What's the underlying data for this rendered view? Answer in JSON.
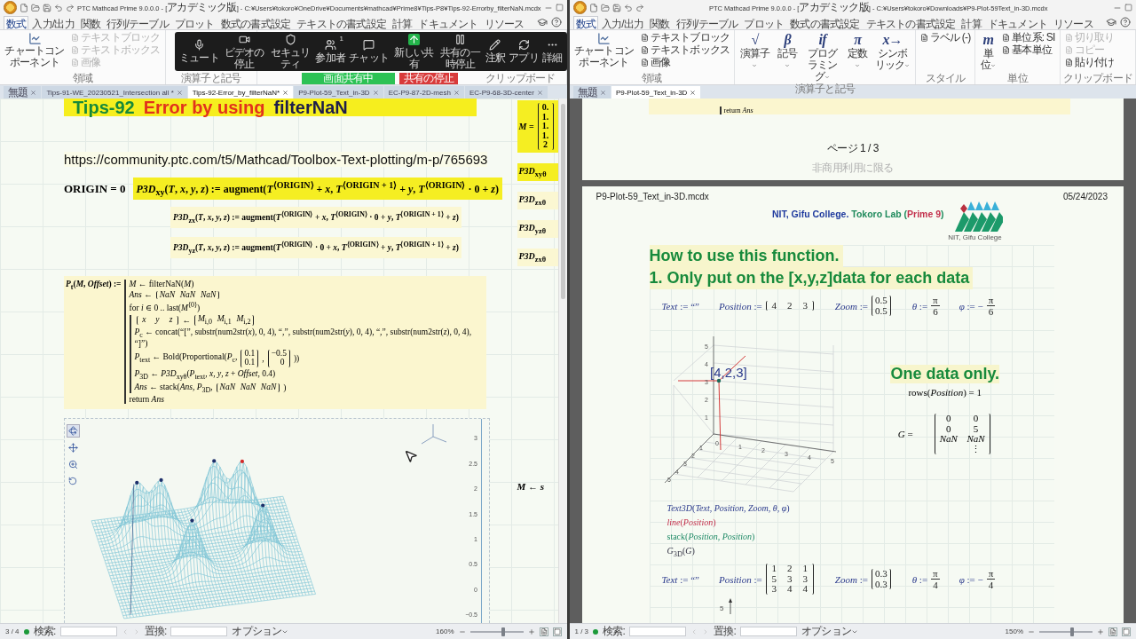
{
  "left": {
    "title": "PTC Mathcad Prime 9.0.0.0 - [アカデミック版] - C:¥Users¥tokoro¥OneDrive¥Documents¥mathcad¥Prime8¥Tips-P8¥Tips-92-Errorby_filterNaN.mcdx",
    "ribbon_tabs": [
      {
        "label": "数式",
        "selected": true
      },
      {
        "label": "入力/出力",
        "selected": false
      },
      {
        "label": "関数",
        "selected": false
      },
      {
        "label": "行列/テーブル",
        "selected": false
      },
      {
        "label": "プロット",
        "selected": false
      },
      {
        "label": "数式の書式設定",
        "selected": false
      },
      {
        "label": "テキストの書式設定",
        "selected": false
      },
      {
        "label": "計算",
        "selected": false
      },
      {
        "label": "ドキュメント",
        "selected": false
      },
      {
        "label": "リソース",
        "selected": false
      }
    ],
    "ribbon_groups": [
      {
        "label": "領域",
        "items": [
          {
            "kind": "chart",
            "label": "チャートコンポーネント",
            "disabled": false
          },
          {
            "kind": "small",
            "label": "テキストブロック",
            "disabled": true
          },
          {
            "kind": "small",
            "label": "テキストボックス",
            "disabled": true
          },
          {
            "kind": "small",
            "label": "画像",
            "disabled": true
          }
        ]
      },
      {
        "label": "演算子と記号"
      },
      {
        "label": "クリップボード"
      }
    ],
    "zoom_toolbar": {
      "items": [
        {
          "kind": "mic",
          "label": "ミュート"
        },
        {
          "kind": "video",
          "label": "ビデオの停止"
        },
        {
          "kind": "security",
          "label": "セキュリティ"
        },
        {
          "kind": "participants",
          "label": "参加者",
          "count": "1"
        },
        {
          "kind": "chat",
          "label": "チャット"
        },
        {
          "kind": "share",
          "label": "新しい共有"
        },
        {
          "kind": "pause",
          "label": "共有の一時停止"
        },
        {
          "kind": "annotate",
          "label": "注釈"
        },
        {
          "kind": "apps",
          "label": "アプリ"
        },
        {
          "kind": "more",
          "label": "詳細"
        }
      ],
      "banner": "画面共有中",
      "stop": "共有の停止"
    },
    "doc_tabs": [
      {
        "label": "無題",
        "selected": false
      },
      {
        "label": "Tips-91-WE_20230521_Intersection all *",
        "selected": false
      },
      {
        "label": "Tips-92-Error_by_filterNaN*",
        "selected": true
      },
      {
        "label": "P9-Plot-59_Text_in-3D",
        "selected": false
      },
      {
        "label": "EC-P9-87-2D-mesh",
        "selected": false
      },
      {
        "label": "EC-P9-68-3D-center",
        "selected": false
      }
    ],
    "document": {
      "heading": [
        {
          "text": "Tips-92",
          "kind": "number"
        },
        {
          "text": "Error by using",
          "kind": "error"
        },
        {
          "text": "filterNaN",
          "kind": "function"
        }
      ],
      "url": "https://community.ptc.com/t5/Mathcad/Toolbox-Text-plotting/m-p/765693",
      "origin": "ORIGIN = 0",
      "definitions": [
        {
          "text": "*P3D*$_{xy}$(*T*, *x*, *y*, *z*) := augment(*T*$^{⟨ORIGIN⟩}$ + *x*, *T*$^{⟨ORIGIN + 1⟩}$ + *y*, *T*$^{⟨ORIGIN⟩}$ · 0 + *z*)",
          "highlighted": true
        },
        {
          "text": "*P3D*$_{zx}$(*T*, *x*, *y*, *z*) := augment(*T*$^{⟨ORIGIN⟩}$ + *x*, *T*$^{⟨ORIGIN⟩}$ · 0 + *y*, *T*$^{⟨ORIGIN + 1⟩}$ + *z*)",
          "highlighted": false
        },
        {
          "text": "*P3D*$_{yz}$(*T*, *x*, *y*, *z*) := augment(*T*$^{⟨ORIGIN⟩}$ · 0 + *x*, *T*$^{⟨ORIGIN⟩}$ + *y*, *T*$^{⟨ORIGIN + 1⟩}$ + *z*)",
          "highlighted": false
        }
      ],
      "program": {
        "head": "*P*$_{t}$(*M*, *Offset*) :=",
        "lines": [
          {
            "parts": [
              {
                "kind": "text",
                "text": "*M* ← filterNaN(*M*)"
              }
            ]
          },
          {
            "parts": [
              {
                "kind": "text",
                "text": "*Ans* ←"
              },
              {
                "kind": "matrix",
                "rows": [
                  [
                    "*NaN*",
                    "*NaN*",
                    "*NaN*"
                  ]
                ]
              }
            ]
          },
          {
            "parts": [
              {
                "kind": "text",
                "text": "for *i* ∈ 0 .. last(*M*$^{⟨0⟩}$)"
              }
            ],
            "children": [
              {
                "parts": [
                  {
                    "kind": "matrix",
                    "rows": [
                      [
                        "*x*",
                        "*y*",
                        "*z*"
                      ]
                    ]
                  },
                  {
                    "kind": "text",
                    "text": "←"
                  },
                  {
                    "kind": "matrix",
                    "rows": [
                      [
                        "*M*$_{i,0}$",
                        "*M*$_{i,1}$",
                        "*M*$_{i,2}$"
                      ]
                    ]
                  }
                ]
              },
              {
                "parts": [
                  {
                    "kind": "text",
                    "text": "*P*$_{c}$ ← concat(“[”, substr(num2str(*x*), 0, 4), “,”, substr(num2str(*y*), 0, 4), “,”, substr(num2str(*z*), 0, 4), “]”)"
                  }
                ]
              },
              {
                "parts": [
                  {
                    "kind": "text",
                    "text": "*P*$_{text}$ ← Bold(Proportional(*P*$_{c}$,"
                  },
                  {
                    "kind": "matrix",
                    "rows": [
                      [
                        "0.1"
                      ],
                      [
                        "0.1"
                      ]
                    ]
                  },
                  {
                    "kind": "text",
                    "text": ","
                  },
                  {
                    "kind": "matrix",
                    "rows": [
                      [
                        "−0.5"
                      ],
                      [
                        "0"
                      ]
                    ]
                  },
                  {
                    "kind": "text",
                    "text": "))"
                  }
                ]
              },
              {
                "parts": [
                  {
                    "kind": "text",
                    "text": "*P*$_{3D}$ ← *P3D*$_{xyθ}$(*P*$_{text}$, *x*, *y*, *z* + *Offset*, 0.4)"
                  }
                ]
              },
              {
                "parts": [
                  {
                    "kind": "text",
                    "text": "*Ans* ← stack(*Ans*, *P*$_{3D}$,"
                  },
                  {
                    "kind": "matrix",
                    "rows": [
                      [
                        "*NaN*",
                        "*NaN*",
                        "*NaN*"
                      ]
                    ]
                  },
                  {
                    "kind": "text",
                    "text": ")"
                  }
                ]
              }
            ]
          },
          {
            "parts": [
              {
                "kind": "text",
                "text": "return *Ans*"
              }
            ]
          }
        ]
      },
      "side": [
        {
          "parts": [
            {
              "kind": "text",
              "text": "*M* ="
            },
            {
              "kind": "matrix",
              "rows": [
                [
                  "0."
                ],
                [
                  "1."
                ],
                [
                  "1."
                ],
                [
                  "1."
                ],
                [
                  "2"
                ]
              ]
            }
          ],
          "highlighted": true
        },
        {
          "parts": [
            {
              "kind": "text",
              "text": "*P3D*$_{xyθ}$"
            }
          ],
          "highlighted": true
        },
        {
          "parts": [
            {
              "kind": "text",
              "text": "*P3D*$_{zxθ}$"
            }
          ],
          "highlighted": false
        },
        {
          "parts": [
            {
              "kind": "text",
              "text": "*P3D*$_{yzθ}$"
            }
          ],
          "highlighted": false
        },
        {
          "parts": [
            {
              "kind": "text",
              "text": "*P3D*$_{zxθ}$"
            }
          ],
          "highlighted": false
        }
      ],
      "side_note": "*M* ← *s*",
      "plot": {
        "z_ticks": [
          "3",
          "2.5",
          "2",
          "1.5",
          "1",
          "0.5",
          "0",
          "−0.5"
        ]
      }
    },
    "status": {
      "page": "3 / 4",
      "search": "検索:",
      "replace": "置換:",
      "options": "オプション",
      "zoom": "160%",
      "zoom_slider": {
        "level": 0.62
      }
    }
  },
  "right": {
    "title": "PTC Mathcad Prime 9.0.0.0 - [アカデミック版] - C:¥Users¥tokoro¥Downloads¥P9-Plot-59Text_in-3D.mcdx",
    "ribbon_tabs": [
      {
        "label": "数式",
        "selected": true
      },
      {
        "label": "入力/出力",
        "selected": false
      },
      {
        "label": "関数",
        "selected": false
      },
      {
        "label": "行列/テーブル",
        "selected": false
      },
      {
        "label": "プロット",
        "selected": false
      },
      {
        "label": "数式の書式設定",
        "selected": false
      },
      {
        "label": "テキストの書式設定",
        "selected": false
      },
      {
        "label": "計算",
        "selected": false
      },
      {
        "label": "ドキュメント",
        "selected": false
      },
      {
        "label": "リソース",
        "selected": false
      }
    ],
    "ribbon_groups": [
      {
        "label": "領域",
        "items": [
          {
            "kind": "chart",
            "label": "チャートコンポーネント",
            "disabled": false
          },
          {
            "kind": "small",
            "label": "テキストブロック",
            "disabled": false
          },
          {
            "kind": "small",
            "label": "テキストボックス",
            "disabled": false
          },
          {
            "kind": "small",
            "label": "画像",
            "disabled": false
          }
        ]
      },
      {
        "label": "演算子と記号",
        "items": [
          {
            "kind": "symbol",
            "glyph": "√",
            "label": "演算子"
          },
          {
            "kind": "symbol",
            "glyph": "β",
            "label": "記号"
          },
          {
            "kind": "symbol",
            "glyph": "if",
            "label": "プログラミング"
          },
          {
            "kind": "symbol",
            "glyph": "π",
            "label": "定数"
          },
          {
            "kind": "symbol",
            "glyph": "x→",
            "label": "シンボリック"
          }
        ]
      },
      {
        "label": "スタイル",
        "items": [
          {
            "kind": "small",
            "label": "ラベル (-)",
            "disabled": false
          }
        ]
      },
      {
        "label": "単位",
        "items": [
          {
            "kind": "symbol",
            "glyph": "m",
            "label": "単位"
          },
          {
            "kind": "small",
            "label": "単位系: SI",
            "disabled": false
          },
          {
            "kind": "small",
            "label": "基本単位",
            "disabled": false
          }
        ]
      },
      {
        "label": "クリップボード",
        "items": [
          {
            "kind": "small",
            "label": "切り取り",
            "disabled": true
          },
          {
            "kind": "small",
            "label": "コピー",
            "disabled": true
          },
          {
            "kind": "small",
            "label": "貼り付け",
            "disabled": false
          }
        ]
      }
    ],
    "doc_tabs": [
      {
        "label": "無題",
        "selected": false
      },
      {
        "label": "P9-Plot-59_Text_in-3D",
        "selected": true
      }
    ],
    "prev_page": {
      "code": "return *Ans*",
      "footer": "ページ 1 / 3",
      "notice": "非商用利用に限る"
    },
    "page": {
      "file": "P9-Plot-59_Text_in-3D.mcdx",
      "date": "05/24/2023",
      "lab": [
        {
          "text": "NIT, Gifu College.",
          "color": "#1f3a9e"
        },
        {
          "text": "Tokoro Lab (",
          "color": "#1f8a5c"
        },
        {
          "text": "Prime 9",
          "color": "#c3304c"
        },
        {
          "text": ")",
          "color": "#1f8a5c"
        }
      ],
      "logo_caption": "NIT, Gifu College",
      "headings": [
        "How to use this function.",
        "1. Only put on the [x,y,z]data for each data"
      ],
      "assign": [
        [
          {
            "kind": "text",
            "text": "*Text* := “”"
          }
        ],
        [
          {
            "kind": "text",
            "text": "*Position* :="
          },
          {
            "kind": "matrix",
            "rows": [
              [
                "4",
                "2",
                "3"
              ]
            ]
          }
        ],
        [
          {
            "kind": "text",
            "text": "*Zoom* :="
          },
          {
            "kind": "matrix",
            "rows": [
              [
                "0.5"
              ],
              [
                "0.5"
              ]
            ]
          }
        ],
        [
          {
            "kind": "text",
            "text": "*θ* :="
          },
          {
            "kind": "fraction",
            "num": "π",
            "den": "6"
          }
        ],
        [
          {
            "kind": "text",
            "text": "*φ* := −"
          },
          {
            "kind": "fraction",
            "num": "π",
            "den": "6"
          }
        ]
      ],
      "plot": {
        "label": "[4,2,3]",
        "x_ticks": [
          "0",
          "1",
          "2",
          "3",
          "4",
          "5"
        ],
        "y_ticks": [
          "5",
          "4",
          "3",
          "2",
          "1"
        ],
        "z_ticks": [
          "5",
          "4",
          "3",
          "2",
          "1"
        ]
      },
      "note": "One data only.",
      "rows_expr": "rows(*Position*) = 1",
      "g_label": "*G* =",
      "g_matrix": [
        [
          "0",
          "0"
        ],
        [
          "0",
          "5"
        ],
        [
          "*NaN*",
          "*NaN*"
        ],
        [
          "⋮"
        ]
      ],
      "calls": [
        {
          "text": "*Text3D*(*Text*, *Position*, *Zoom*, *θ*, *φ*)",
          "kind": "text"
        },
        {
          "text": "*line*(*Position*)",
          "kind": "line"
        },
        {
          "text": "stack(*Position*, *Position*)",
          "kind": "stack"
        },
        {
          "text": "*G*$_{3D}$(*G*)",
          "kind": "graph"
        }
      ],
      "assign2": [
        [
          {
            "kind": "text",
            "text": "*Text* := “”"
          }
        ],
        [
          {
            "kind": "text",
            "text": "*Position* :="
          },
          {
            "kind": "matrix",
            "rows": [
              [
                "1",
                "2",
                "1"
              ],
              [
                "5",
                "3",
                "3"
              ],
              [
                "3",
                "4",
                "4"
              ]
            ]
          }
        ],
        [
          {
            "kind": "text",
            "text": "*Zoom* :="
          },
          {
            "kind": "matrix",
            "rows": [
              [
                "0.3"
              ],
              [
                "0.3"
              ]
            ]
          }
        ],
        [
          {
            "kind": "text",
            "text": "*θ* :="
          },
          {
            "kind": "fraction",
            "num": "π",
            "den": "4"
          }
        ],
        [
          {
            "kind": "text",
            "text": "*φ* := −"
          },
          {
            "kind": "fraction",
            "num": "π",
            "den": "4"
          }
        ]
      ],
      "bottom_tick": "5"
    },
    "status": {
      "page": "1 / 3",
      "search": "検索:",
      "replace": "置換:",
      "options": "オプション",
      "zoom": "150%",
      "zoom_slider": {
        "level": 0.62
      }
    }
  }
}
